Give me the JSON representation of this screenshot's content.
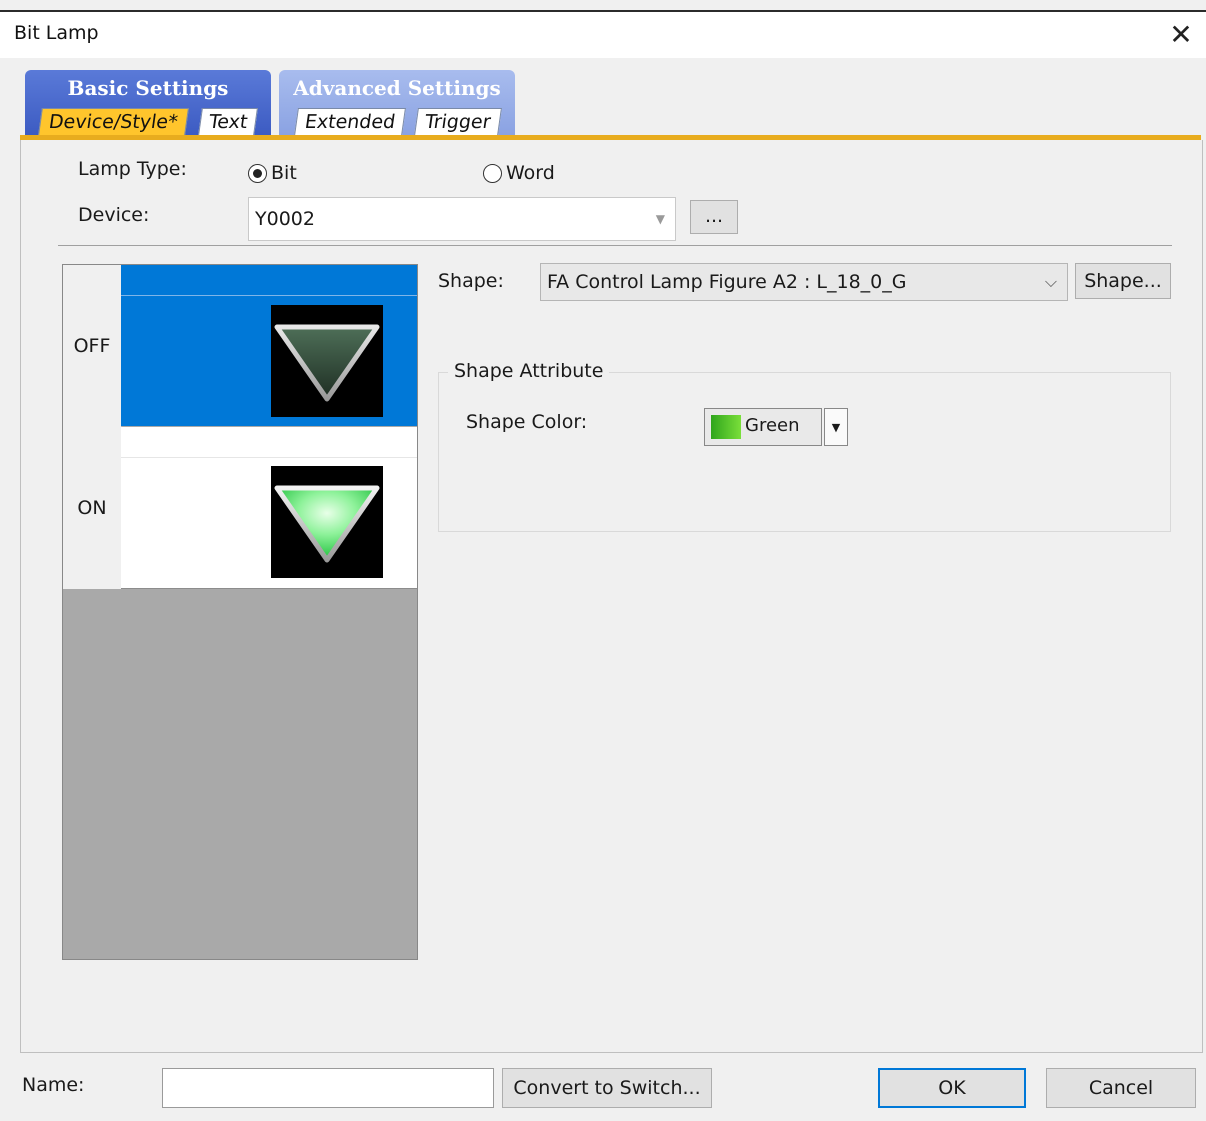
{
  "window": {
    "title": "Bit Lamp",
    "close_symbol": "✕"
  },
  "tab_groups": {
    "basic": {
      "label": "Basic Settings",
      "tabs": [
        "Device/Style*",
        "Text"
      ]
    },
    "advanced": {
      "label": "Advanced Settings",
      "tabs": [
        "Extended",
        "Trigger"
      ]
    }
  },
  "lamp_type": {
    "label": "Lamp Type:",
    "options": [
      "Bit",
      "Word"
    ],
    "selected": "Bit"
  },
  "device": {
    "label": "Device:",
    "value": "Y0002",
    "browse_label": "..."
  },
  "preview": {
    "states": [
      "OFF",
      "ON"
    ],
    "selected": "OFF"
  },
  "shape": {
    "label": "Shape:",
    "value": "FA Control Lamp Figure A2 : L_18_0_G",
    "button_label": "Shape..."
  },
  "shape_attribute": {
    "title": "Shape Attribute",
    "color_label": "Shape Color:",
    "color_value": "Green",
    "color_hex": "#4fc22a"
  },
  "footer": {
    "name_label": "Name:",
    "name_value": "",
    "convert_label": "Convert to Switch...",
    "ok_label": "OK",
    "cancel_label": "Cancel"
  },
  "colors": {
    "selection": "#0078d7",
    "tab_active": "#ffc52c",
    "accent_line": "#e8ac1e"
  }
}
